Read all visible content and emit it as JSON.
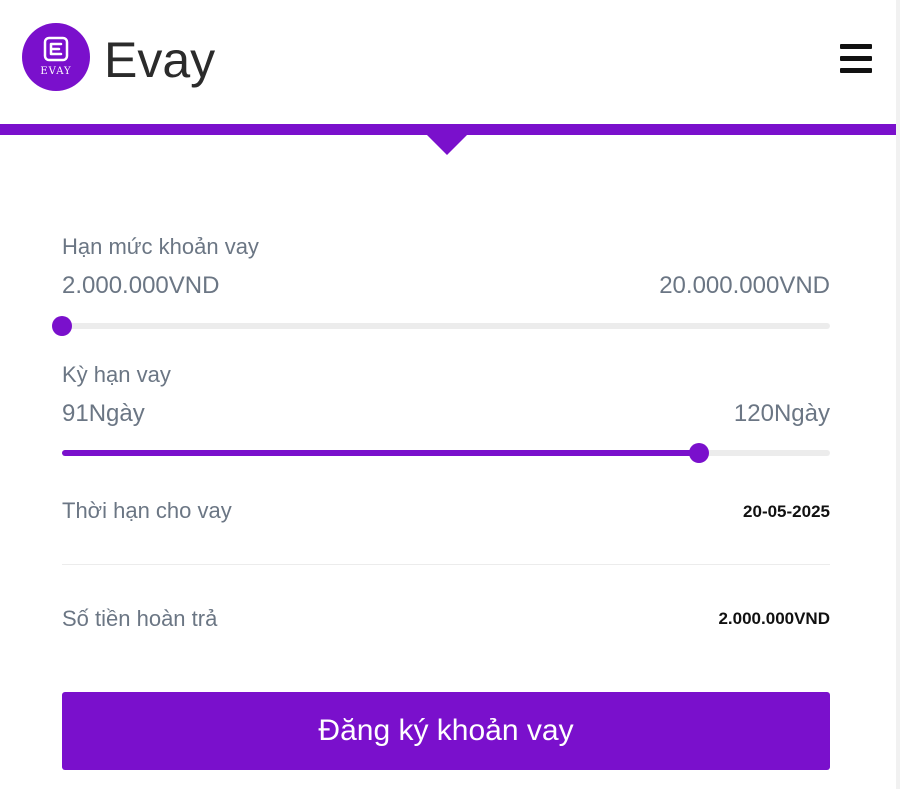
{
  "header": {
    "logo_text": "EVAY",
    "brand": "Evay",
    "menu_icon": "hamburger-menu-icon"
  },
  "loan_limit": {
    "label": "Hạn mức khoản vay",
    "min_label": "2.000.000VND",
    "max_label": "20.000.000VND",
    "value_fraction": 0.0
  },
  "loan_term": {
    "label": "Kỳ hạn vay",
    "min_label": "91Ngày",
    "max_label": "120Ngày",
    "value_fraction": 0.83
  },
  "summary": {
    "due_date_label": "Thời hạn cho vay",
    "due_date_value": "20-05-2025",
    "repayment_label": "Số tiền hoàn trả",
    "repayment_value": "2.000.000VND"
  },
  "submit_label": "Đăng ký khoản vay",
  "colors": {
    "accent": "#7a10cc",
    "text_muted": "#6b7684",
    "track": "#ececec"
  }
}
